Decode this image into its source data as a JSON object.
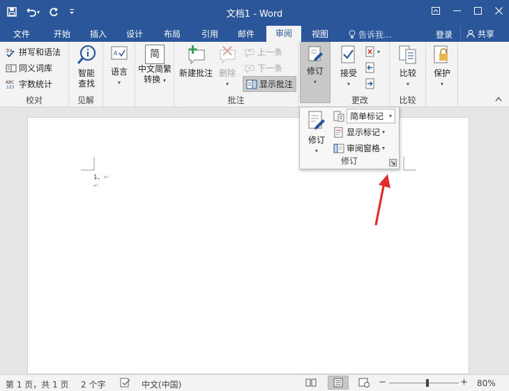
{
  "window": {
    "title": "文档1 - Word",
    "accent": "#2b579a"
  },
  "tabs": [
    "文件",
    "开始",
    "插入",
    "设计",
    "布局",
    "引用",
    "邮件",
    "审阅",
    "视图"
  ],
  "active_tab": "审阅",
  "tell_me": "告诉我...",
  "account": {
    "login": "登录",
    "share": "共享"
  },
  "ribbon": {
    "proofing": {
      "spelling": "拼写和语法",
      "thesaurus": "同义词库",
      "word_count": "字数统计",
      "label": "校对"
    },
    "insights": {
      "smart_lookup": [
        "智能",
        "查找"
      ],
      "label": "见解"
    },
    "language": {
      "language": "语言"
    },
    "chinese": {
      "convert": [
        "中文简繁",
        "转换"
      ],
      "glyph": "简"
    },
    "comments": {
      "new_comment": "新建批注",
      "delete": "删除",
      "previous": "上一条",
      "next": "下一条",
      "show_comments": "显示批注",
      "label": "批注"
    },
    "tracking": {
      "track_changes": "修订"
    },
    "changes": {
      "accept": "接受",
      "label": "更改"
    },
    "compare": {
      "compare": "比较",
      "label": "比较"
    },
    "protect": {
      "protect": "保护"
    }
  },
  "popup": {
    "track_changes": "修订",
    "markup_mode": "简单标记",
    "show_markup": "显示标记",
    "reviewing_pane": "审阅窗格",
    "label": "修订"
  },
  "document": {
    "line1": "1、",
    "line2": ""
  },
  "statusbar": {
    "page": "第 1 页，共 1 页",
    "words": "2 个字",
    "language": "中文(中国)",
    "zoom": "80%",
    "zoom_fraction": 0.55
  }
}
